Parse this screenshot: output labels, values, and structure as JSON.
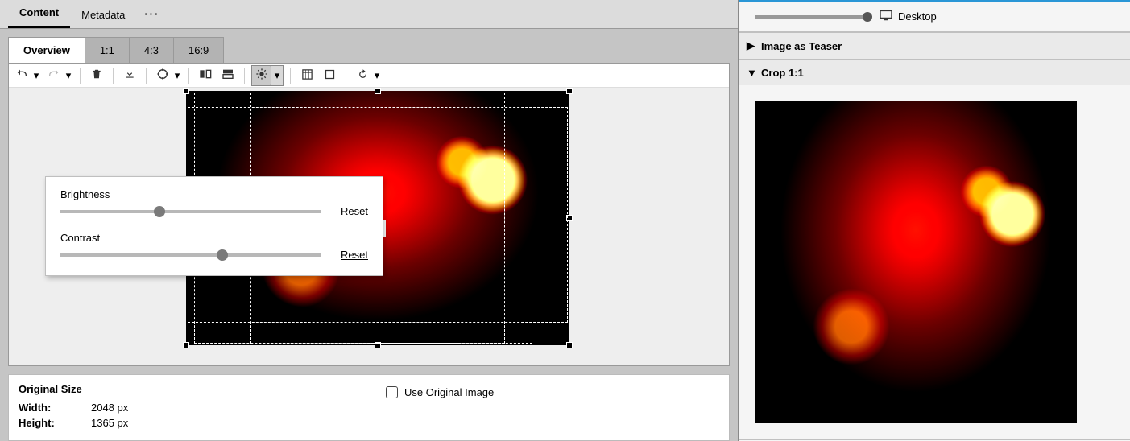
{
  "topTabs": {
    "content": "Content",
    "metadata": "Metadata"
  },
  "subTabs": {
    "overview": "Overview",
    "r11": "1:1",
    "r43": "4:3",
    "r169": "16:9"
  },
  "popup": {
    "brightnessLabel": "Brightness",
    "contrastLabel": "Contrast",
    "resetLabel": "Reset",
    "brightnessPct": 38,
    "contrastPct": 62
  },
  "bottom": {
    "title": "Original Size",
    "widthLabel": "Width:",
    "widthValue": "2048 px",
    "heightLabel": "Height:",
    "heightValue": "1365 px",
    "useOriginal": "Use Original Image"
  },
  "rightPanel": {
    "deviceLabel": "Desktop",
    "acc1": "Image as Teaser",
    "acc2": "Crop 1:1"
  },
  "icons": {
    "undo": "undo",
    "redo": "redo",
    "trash": "trash",
    "download": "download",
    "focus": "focus",
    "flipH": "flip-h",
    "flipV": "flip-v",
    "brightness": "brightness",
    "cropGrid": "crop-grid",
    "cropFree": "crop-free",
    "rotate": "rotate",
    "desktop": "desktop"
  }
}
